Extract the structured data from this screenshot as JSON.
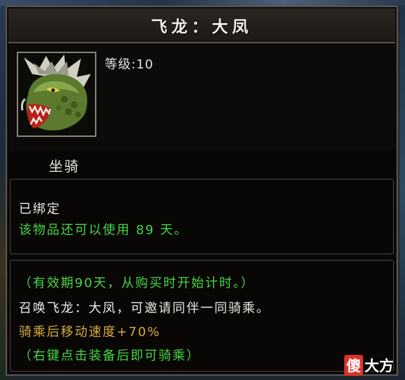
{
  "item": {
    "name": "飞龙：大凤",
    "level": "等级:10",
    "type": "坐骑"
  },
  "status": {
    "bound": "已绑定",
    "remaining": "该物品还可以使用 89 天。"
  },
  "description": {
    "validity": "（有效期90天，从购买时开始计时。）",
    "summon": "召唤飞龙：大凤，可邀请同伴一同骑乘。",
    "bonus": "骑乘后移动速度+70%",
    "usage": "（右键点击装备后即可骑乘）"
  },
  "watermark": {
    "mark": "傻",
    "text": "大方"
  },
  "icons": {
    "item_icon": "dragon-head-icon"
  },
  "colors": {
    "white_text": "#ecebe4",
    "green_text": "#45d642",
    "gold_text": "#d8ac3e",
    "border": "#5c564e"
  }
}
